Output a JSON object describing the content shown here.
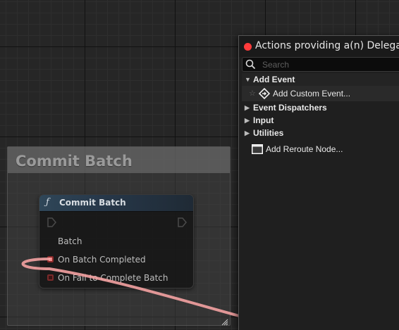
{
  "comment": {
    "title": "Commit Batch"
  },
  "node": {
    "title": "Commit Batch",
    "icon": "function-icon",
    "pins": {
      "batch": "Batch",
      "on_completed": "On Batch Completed",
      "on_fail": "On Fail to Complete Batch"
    }
  },
  "menu": {
    "title": "Actions providing a(n) Delegate",
    "search_placeholder": "Search",
    "items": [
      {
        "label": "Add Event",
        "type": "category",
        "expanded": true
      },
      {
        "label": "Add Custom Event...",
        "type": "action",
        "icon": "custom-event-icon"
      },
      {
        "label": "Event Dispatchers",
        "type": "category",
        "expanded": false
      },
      {
        "label": "Input",
        "type": "category",
        "expanded": false
      },
      {
        "label": "Utilities",
        "type": "category",
        "expanded": false
      },
      {
        "label": "Add Reroute Node...",
        "type": "action",
        "icon": "reroute-node-icon"
      }
    ]
  },
  "colors": {
    "delegate_pin": "#f08a8a",
    "wire": "#f4a2a2",
    "function_header": "#2f4658",
    "title_dot": "#ff3b3b"
  }
}
